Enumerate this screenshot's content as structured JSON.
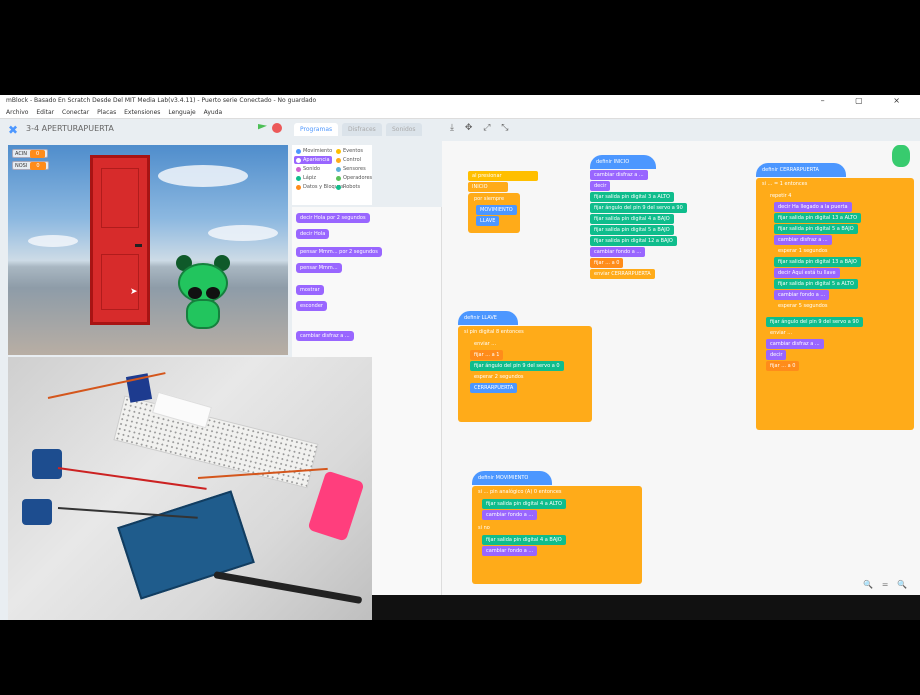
{
  "window": {
    "title": "mBlock - Basado En Scratch Desde Del MIT Media Lab(v3.4.11) - Puerto serie Conectado - No guardado",
    "controls": "–  ▢  ×"
  },
  "menu": [
    "Archivo",
    "Editar",
    "Conectar",
    "Placas",
    "Extensiones",
    "Lenguaje",
    "Ayuda"
  ],
  "project": {
    "title": "3-4 APERTURAPUERTA"
  },
  "tabs": {
    "active": "Programas",
    "inactive": [
      "Disfraces",
      "Sonidos"
    ]
  },
  "monitors": [
    {
      "label": "ACIN",
      "value": "0"
    },
    {
      "label": "NOSI",
      "value": "0"
    }
  ],
  "categories": [
    {
      "label": "Movimiento",
      "color": "#4c97ff"
    },
    {
      "label": "Apariencia",
      "color": "#9966ff"
    },
    {
      "label": "Sonido",
      "color": "#cf63cf"
    },
    {
      "label": "Lápiz",
      "color": "#0fbd8c"
    },
    {
      "label": "Datos y Bloques",
      "color": "#ff8c1a"
    },
    {
      "label": "Eventos",
      "color": "#ffbf00"
    },
    {
      "label": "Control",
      "color": "#ffab19"
    },
    {
      "label": "Sensores",
      "color": "#5cb1d6"
    },
    {
      "label": "Operadores",
      "color": "#59c059"
    },
    {
      "label": "Robots",
      "color": "#0fbd8c"
    }
  ],
  "palette_blocks": [
    "decir Hola por 2 segundos",
    "decir Hola",
    "pensar Mmm... por 2 segundos",
    "pensar Mmm...",
    "mostrar",
    "esconder",
    "cambiar disfraz a ..."
  ],
  "scripts": {
    "main": [
      "al presionar",
      "INICIO",
      "por siempre",
      "MOVIMIENTO",
      "LLAVE"
    ],
    "inicio": [
      "definir INICIO",
      "cambiar disfraz a ...",
      "decir",
      "fijar salida pin digital 3 a ALTO",
      "fijar ángulo del pin 9 del servo a 90",
      "fijar salida pin digital 4 a BAJO",
      "fijar salida pin digital 5 a BAJO",
      "fijar salida pin digital 12 a BAJO",
      "cambiar fondo a ...",
      "fijar ... a 0",
      "enviar CERRARPUERTA"
    ],
    "llave": [
      "definir LLAVE",
      "si pin digital 8 entonces",
      "enviar ...",
      "fijar ... a 1",
      "fijar ángulo del pin 9 del servo a 0",
      "esperar 2 segundos",
      "CERRARPUERTA"
    ],
    "cerrar": [
      "definir CERRARPUERTA",
      "si ... = 1 entonces",
      "repetir 4",
      "decir Ha llegado a la puerta",
      "fijar salida pin digital 13 a ALTO",
      "fijar salida pin digital 5 a BAJO",
      "cambiar disfraz a ...",
      "esperar 1 segundos",
      "fijar salida pin digital 13 a BAJO",
      "decir Aquí está tu llave",
      "fijar salida pin digital 5 a ALTO",
      "cambiar fondo a ...",
      "esperar 5 segundos",
      "fijar ángulo del pin 9 del servo a 90",
      "enviar ...",
      "cambiar disfraz a ...",
      "decir",
      "fijar ... a 0"
    ],
    "movimiento": [
      "definir MOVIMIENTO",
      "si ... pin analógico (A) 0 entonces",
      "fijar salida pin digital 4 a ALTO",
      "cambiar fondo a ...",
      "si no",
      "fijar salida pin digital 4 a BAJO",
      "cambiar fondo a ..."
    ]
  },
  "icons": {
    "logo": "scratch-cat-icon",
    "flag": "green-flag-icon",
    "stop": "stop-icon",
    "cursor": "arrow-cursor-icon"
  },
  "zoom": "🔍 = 🔍",
  "edit_tools": "⤓ ✥ ⤢ ⤡"
}
